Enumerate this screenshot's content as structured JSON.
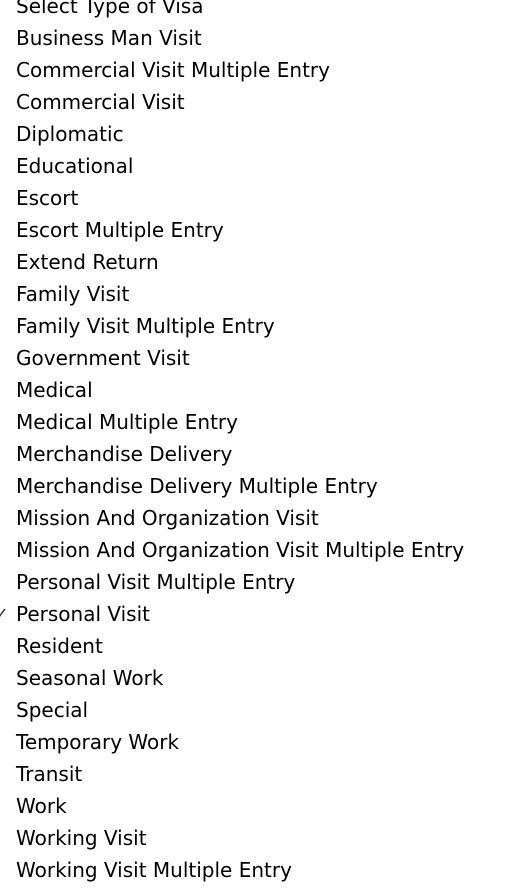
{
  "visa_select": {
    "selected": "Personal Visit",
    "options": [
      "Select Type of Visa",
      "Business Man Visit",
      "Commercial Visit Multiple Entry",
      "Commercial Visit",
      "Diplomatic",
      "Educational",
      "Escort",
      "Escort Multiple Entry",
      "Extend Return",
      "Family Visit",
      "Family Visit Multiple Entry",
      "Government Visit",
      "Medical",
      "Medical Multiple Entry",
      "Merchandise Delivery",
      "Merchandise Delivery Multiple Entry",
      "Mission And Organization Visit",
      "Mission And Organization Visit Multiple Entry",
      "Personal Visit Multiple Entry",
      "Personal Visit",
      "Resident",
      "Seasonal Work",
      "Special",
      "Temporary Work",
      "Transit",
      "Work",
      "Working Visit",
      "Working Visit Multiple Entry"
    ]
  },
  "icons": {
    "checkmark": "✓"
  }
}
